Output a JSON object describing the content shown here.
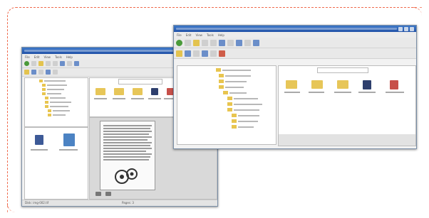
{
  "frame": {
    "accent": "#ef6a4c"
  },
  "window_back": {
    "menu": [
      "File",
      "Edit",
      "View",
      "Tools",
      "Help"
    ],
    "status_left": "Disk: img-002.tif",
    "status_right": "Pages: 3"
  },
  "window_front": {
    "menu": [
      "File",
      "Edit",
      "View",
      "Tools",
      "Help"
    ]
  }
}
